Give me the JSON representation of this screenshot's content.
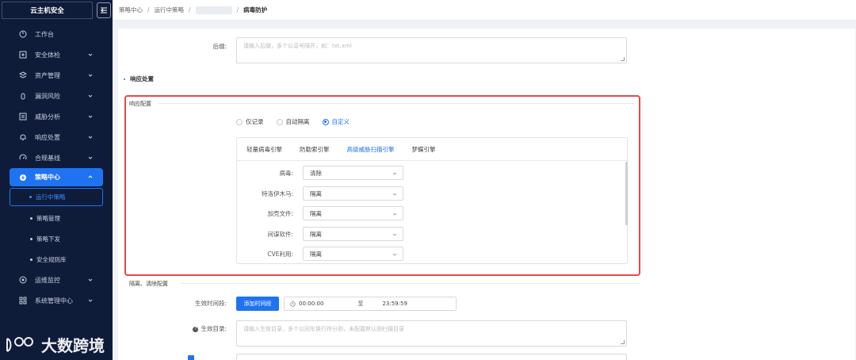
{
  "sidebar": {
    "title": "云主机安全",
    "items": [
      {
        "label": "工作台",
        "icon": "dashboard-icon",
        "arrow": false
      },
      {
        "label": "安全体检",
        "icon": "plus-square-icon",
        "arrow": true
      },
      {
        "label": "资产管理",
        "icon": "layers-icon",
        "arrow": true
      },
      {
        "label": "漏洞风险",
        "icon": "bug-icon",
        "arrow": true
      },
      {
        "label": "威胁分析",
        "icon": "list-icon",
        "arrow": true
      },
      {
        "label": "响应处置",
        "icon": "bell-icon",
        "arrow": true
      },
      {
        "label": "合规基线",
        "icon": "gauge-icon",
        "arrow": true
      }
    ],
    "active": {
      "label": "策略中心",
      "icon": "shield-icon"
    },
    "subitems": [
      "运行中策略",
      "策略管理",
      "策略下发",
      "安全规则库"
    ],
    "bottom_items": [
      {
        "label": "运维监控",
        "icon": "monitor-icon"
      },
      {
        "label": "系统管理中心",
        "icon": "settings-icon"
      }
    ],
    "watermark": "大数跨境"
  },
  "breadcrumb": [
    "策略中心",
    "运行中策略",
    "病毒防护"
  ],
  "form": {
    "suffix_label": "后缀:",
    "suffix_placeholder": "请输入后缀，多个以逗号隔开，如：txt,xml",
    "response_section": "响应处置",
    "response_config": "响应配置",
    "radios": [
      "仅记录",
      "自动隔离",
      "自定义"
    ],
    "radio_selected": 2,
    "engine_tabs": [
      "轻量病毒引擎",
      "防勒索引擎",
      "高级威胁扫描引擎",
      "梦蝶引擎"
    ],
    "engine_tab_selected": 2,
    "engine_rows": [
      {
        "label": "病毒:",
        "value": "清除"
      },
      {
        "label": "特洛伊木马:",
        "value": "隔离"
      },
      {
        "label": "加壳文件:",
        "value": "隔离"
      },
      {
        "label": "间谍软件:",
        "value": "隔离"
      },
      {
        "label": "CVE利用:",
        "value": "隔离"
      }
    ],
    "quarantine_section": "隔离、清除配置",
    "effective_time_label": "生效时间段:",
    "add_time_button": "添加时间段",
    "time_start": "00:00:00",
    "time_to": "至",
    "time_end": "23:59:59",
    "effective_dir_label": "生效目录:",
    "effective_dir_placeholder": "请输入生效目录，多个以回车换行符分割，未配置默认则扫描目录"
  },
  "colors": {
    "accent": "#1f73f1",
    "sidebar_bg": "#0f1c39",
    "highlight": "#e34a4a"
  }
}
